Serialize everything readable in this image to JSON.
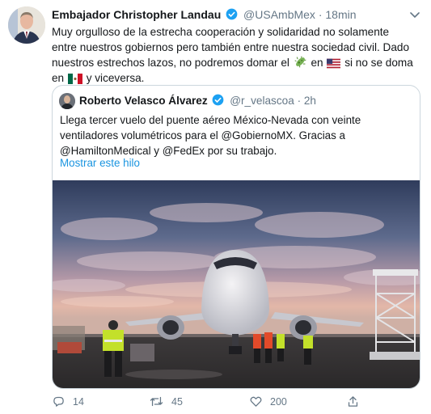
{
  "tweet": {
    "author_name": "Embajador Christopher Landau",
    "handle": "@USAmbMex",
    "separator": "·",
    "time": "18min",
    "text": {
      "part1": "Muy orgulloso de la estrecha cooperación y solidaridad no solamente entre nuestros gobiernos pero también entre nuestra sociedad civil. Dado nuestros estrechos lazos, no podremos domar el",
      "part2": "en",
      "part3": "si no se doma en",
      "part4": "y viceversa."
    },
    "emojis": [
      "microbe-icon",
      "us-flag-icon",
      "mexico-flag-icon"
    ]
  },
  "quoted": {
    "author_name": "Roberto Velasco Álvarez",
    "handle": "@r_velascoa",
    "separator": "·",
    "time": "2h",
    "text": "Llega tercer vuelo del puente aéreo México-Nevada con veinte ventiladores volumétricos para el @GobiernoMX. Gracias a @HamiltonMedical y @FedEx por su trabajo.",
    "show_thread": "Mostrar este hilo"
  },
  "actions": {
    "replies": "14",
    "retweets": "45",
    "likes": "200"
  },
  "colors": {
    "accent": "#1b95e0",
    "verified": "#1da1f2",
    "muted": "#657786",
    "border": "#ccd6dd"
  }
}
